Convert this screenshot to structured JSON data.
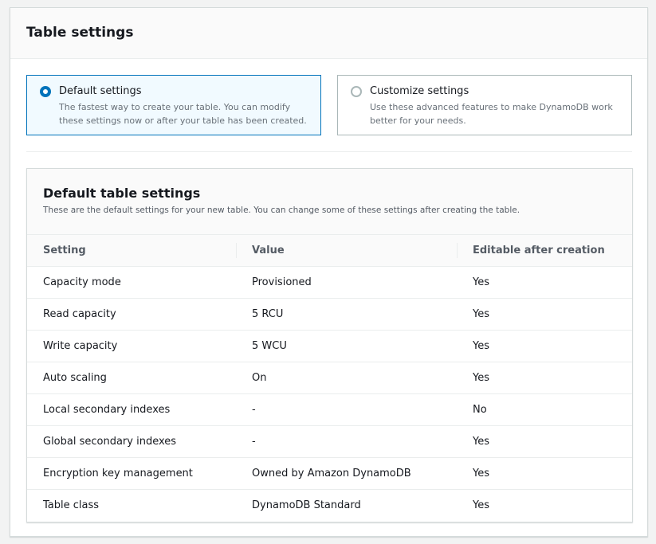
{
  "panel": {
    "title": "Table settings"
  },
  "options": [
    {
      "label": "Default settings",
      "description": "The fastest way to create your table. You can modify these settings now or after your table has been created.",
      "selected": true
    },
    {
      "label": "Customize settings",
      "description": "Use these advanced features to make DynamoDB work better for your needs.",
      "selected": false
    }
  ],
  "defaults": {
    "title": "Default table settings",
    "description": "These are the default settings for your new table. You can change some of these settings after creating the table.",
    "columns": [
      "Setting",
      "Value",
      "Editable after creation"
    ],
    "rows": [
      [
        "Capacity mode",
        "Provisioned",
        "Yes"
      ],
      [
        "Read capacity",
        "5 RCU",
        "Yes"
      ],
      [
        "Write capacity",
        "5 WCU",
        "Yes"
      ],
      [
        "Auto scaling",
        "On",
        "Yes"
      ],
      [
        "Local secondary indexes",
        "-",
        "No"
      ],
      [
        "Global secondary indexes",
        "-",
        "Yes"
      ],
      [
        "Encryption key management",
        "Owned by Amazon DynamoDB",
        "Yes"
      ],
      [
        "Table class",
        "DynamoDB Standard",
        "Yes"
      ]
    ]
  },
  "colors": {
    "accent": "#0073bb",
    "selected_bg": "#f1faff"
  }
}
